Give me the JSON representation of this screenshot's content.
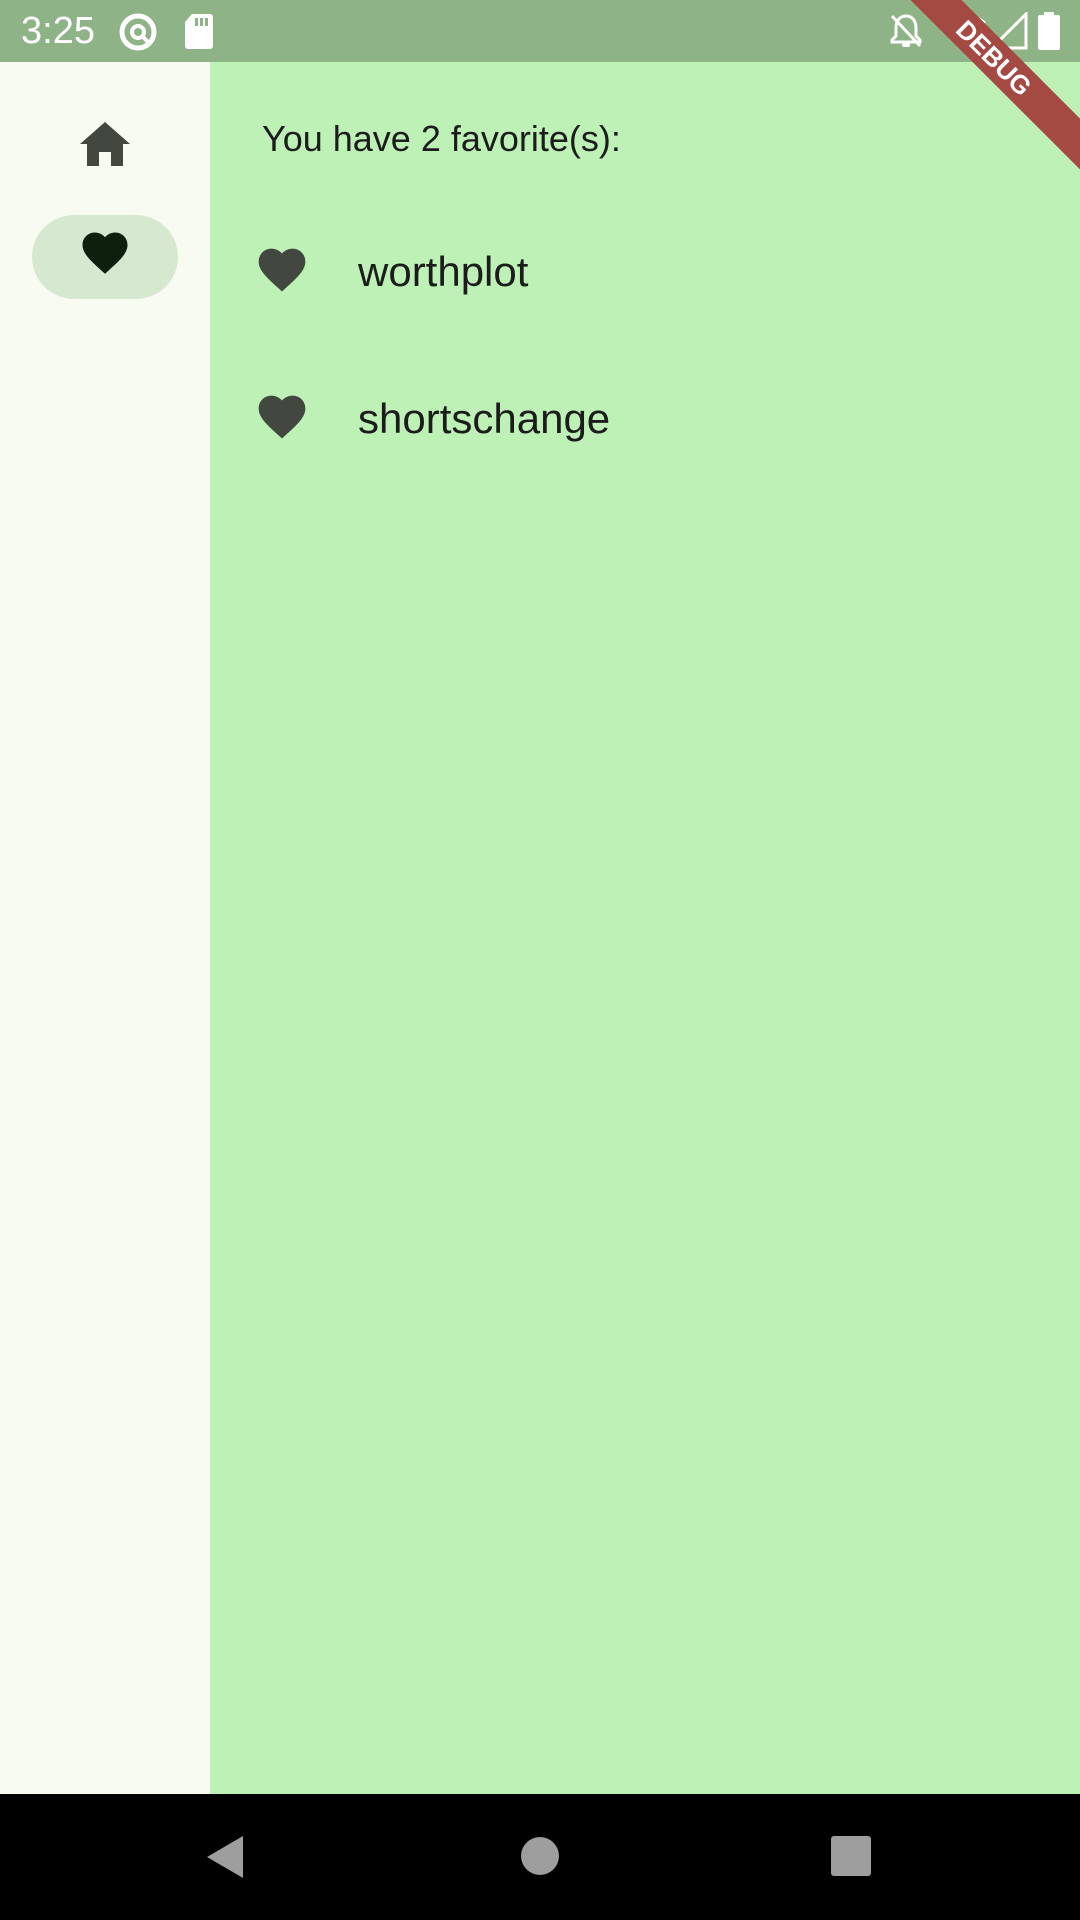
{
  "status_bar": {
    "time": "3:25",
    "icons": [
      "at-sign-icon",
      "sd-card-icon",
      "bell-off-icon",
      "wifi-icon",
      "signal-icon",
      "battery-icon"
    ]
  },
  "debug_banner": {
    "label": "DEBUG"
  },
  "nav_rail": {
    "destinations": [
      {
        "name": "home",
        "icon": "home-icon",
        "selected": false
      },
      {
        "name": "favorites",
        "icon": "heart-icon",
        "selected": true
      }
    ]
  },
  "favorites": {
    "header": "You have 2 favorite(s):",
    "items": [
      "worthplot",
      "shortschange"
    ]
  },
  "system_nav": {
    "buttons": [
      "back-icon",
      "home-circle-icon",
      "recents-icon"
    ]
  },
  "colors": {
    "main_background": "#bdf1b5",
    "rail_background": "#f7fbf1",
    "rail_selected_pill": "#d7e8d0",
    "status_bar": "#8eb386",
    "icon_dark": "#42483f",
    "debug_banner": "#a44a43"
  }
}
